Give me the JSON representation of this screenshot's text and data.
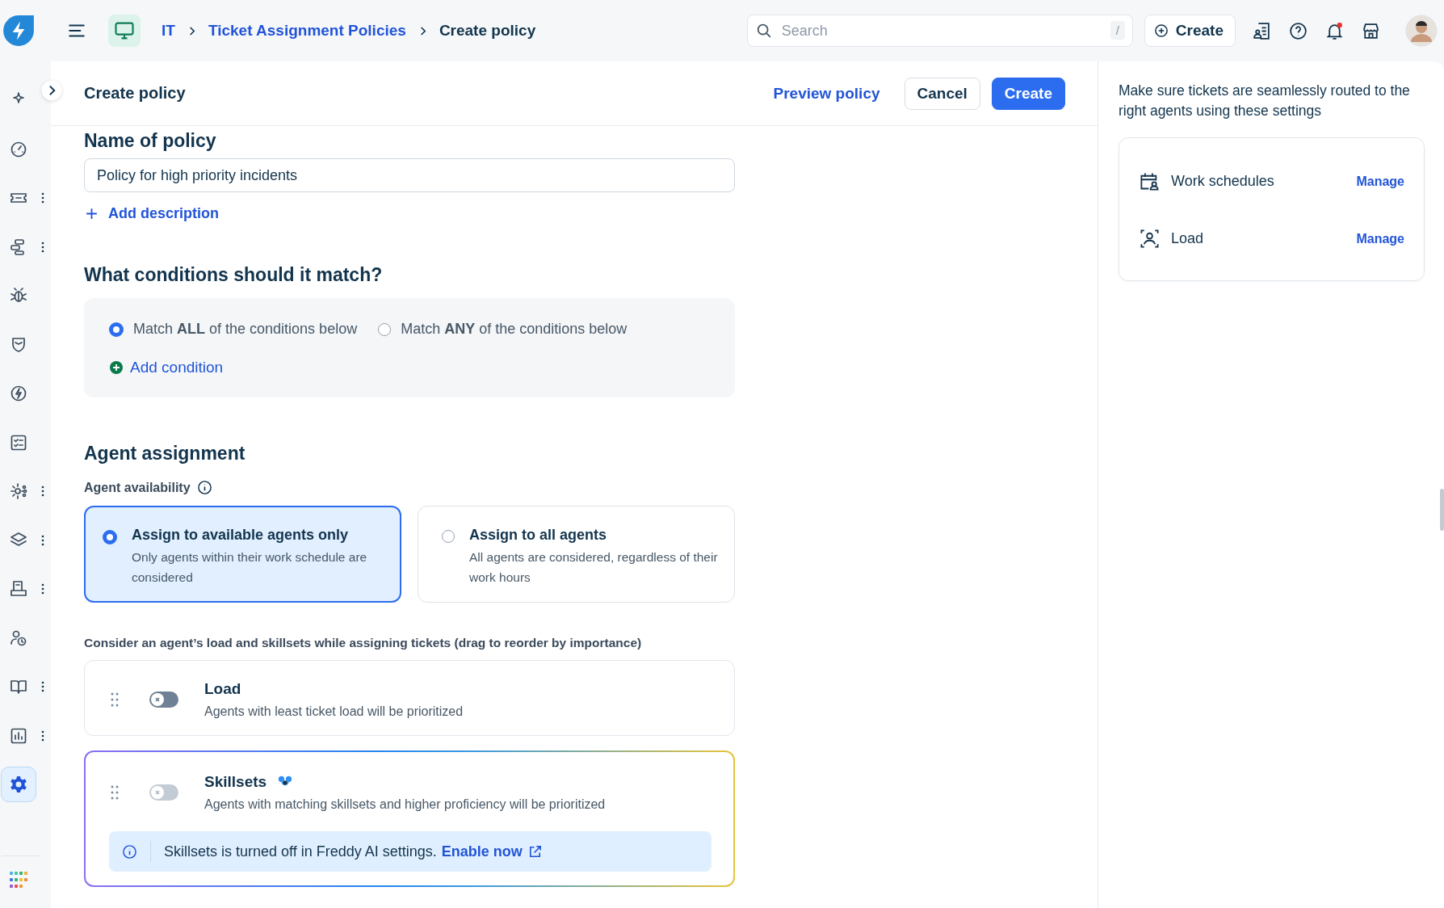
{
  "topbar": {
    "breadcrumb": [
      {
        "label": "IT",
        "link": true
      },
      {
        "label": "Ticket Assignment Policies",
        "link": true
      },
      {
        "label": "Create policy",
        "link": false
      }
    ],
    "search": {
      "placeholder": "Search",
      "shortcut": "/"
    },
    "create_button": "Create",
    "notification_unread": true
  },
  "sidebar": {
    "items": [
      {
        "selected": false,
        "menu": false
      },
      {
        "selected": false,
        "menu": false
      },
      {
        "selected": false,
        "menu": true
      },
      {
        "selected": false,
        "menu": true
      },
      {
        "selected": false,
        "menu": false
      },
      {
        "selected": false,
        "menu": false
      },
      {
        "selected": false,
        "menu": false
      },
      {
        "selected": false,
        "menu": false
      },
      {
        "selected": false,
        "menu": true
      },
      {
        "selected": false,
        "menu": true
      },
      {
        "selected": false,
        "menu": true
      },
      {
        "selected": false,
        "menu": false
      },
      {
        "selected": false,
        "menu": true
      },
      {
        "selected": false,
        "menu": true
      },
      {
        "selected": true,
        "menu": false
      }
    ]
  },
  "header": {
    "title": "Create policy",
    "preview": "Preview policy",
    "cancel": "Cancel",
    "create": "Create"
  },
  "name_field": {
    "label": "Name of policy",
    "value": "Policy for high priority incidents"
  },
  "add_description": "Add description",
  "conditions": {
    "heading": "What conditions should it match?",
    "options": [
      {
        "label": "Match **ALL** of the conditions below",
        "selected": true
      },
      {
        "label": "Match **ANY** of the conditions below",
        "selected": false
      }
    ],
    "add": "Add condition"
  },
  "agent_assignment": {
    "heading": "Agent assignment",
    "availability_label": "Agent availability",
    "options": [
      {
        "title": "Assign to available agents only",
        "description": "Only agents within their work schedule are considered",
        "selected": true
      },
      {
        "title": "Assign to all agents",
        "description": "All agents are considered, regardless of their work hours",
        "selected": false
      }
    ],
    "factors_label": "Consider an agent’s load and skillsets while assigning tickets (drag to reorder by importance)",
    "factors": [
      {
        "title": "Load",
        "description": "Agents with least ticket load will be prioritized",
        "on": false,
        "disabled": false,
        "ai": false
      },
      {
        "title": "Skillsets",
        "description": "Agents with matching skillsets and higher proficiency will be prioritized",
        "on": false,
        "disabled": true,
        "ai": true,
        "notice": {
          "text": "Skillsets is turned off in Freddy AI settings.",
          "link": "Enable now"
        }
      }
    ]
  },
  "side_panel": {
    "intro": "Make sure tickets are seamlessly routed to the right agents using these settings",
    "settings": [
      {
        "label": "Work schedules",
        "action": "Manage"
      },
      {
        "label": "Load",
        "action": "Manage"
      }
    ]
  }
}
